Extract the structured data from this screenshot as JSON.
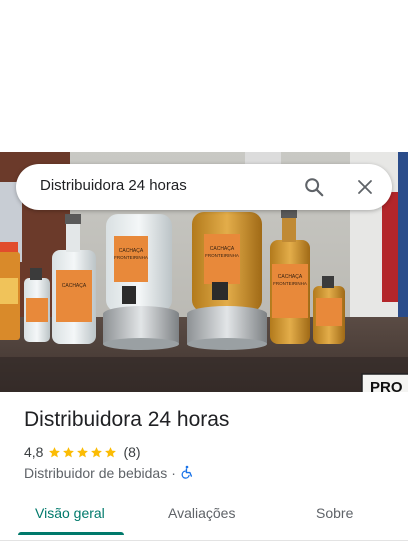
{
  "search": {
    "query": "Distribuidora 24 horas"
  },
  "photo": {
    "bottle_labels": [
      "CACHAÇA",
      "FRONTEIRINHA"
    ],
    "sign_text": "PRO"
  },
  "place": {
    "name": "Distribuidora 24 horas",
    "rating": "4,8",
    "rating_value": 4.8,
    "stars": 5,
    "review_count": "(8)",
    "category": "Distribuidor de bebidas",
    "separator": "·",
    "accessibility_icon": "wheelchair-icon"
  },
  "tabs": [
    {
      "label": "Visão geral",
      "active": true
    },
    {
      "label": "Avaliações",
      "active": false
    },
    {
      "label": "Sobre",
      "active": false
    }
  ],
  "colors": {
    "accent": "#00796b",
    "star": "#fbbc04",
    "accessibility": "#1a73e8"
  }
}
